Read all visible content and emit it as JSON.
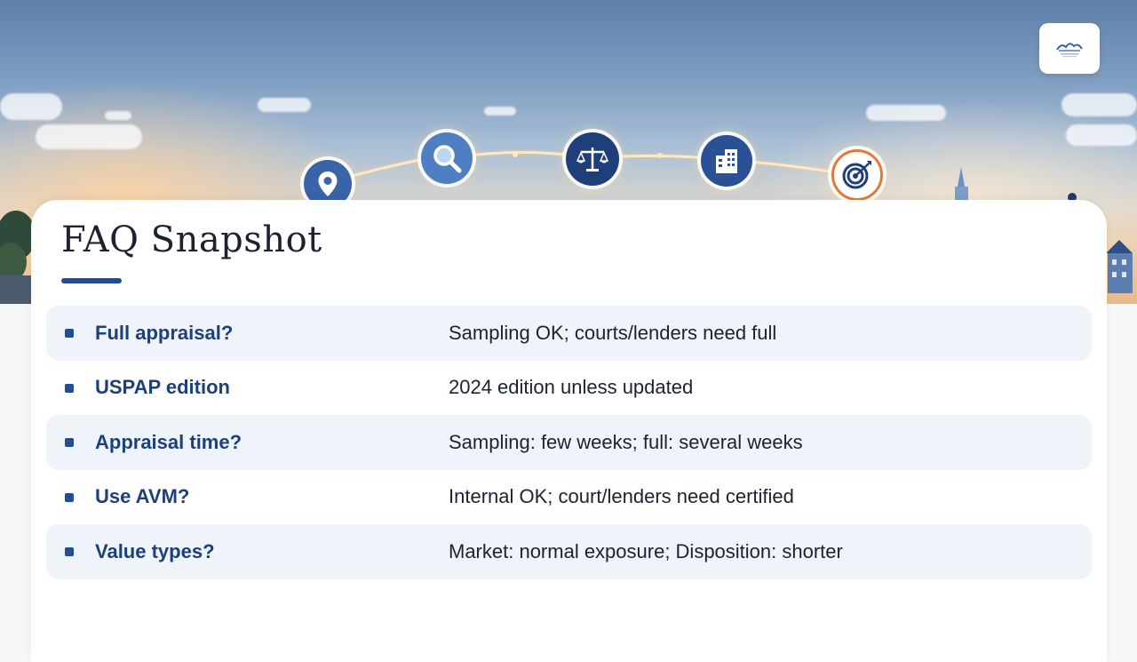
{
  "slide": {
    "title": "FAQ Snapshot"
  },
  "faq": [
    {
      "question": "Full appraisal?",
      "answer": "Sampling OK; courts/lenders need full"
    },
    {
      "question": "USPAP edition",
      "answer": "2024 edition unless updated"
    },
    {
      "question": "Appraisal time?",
      "answer": "Sampling: few weeks; full: several weeks"
    },
    {
      "question": "Use AVM?",
      "answer": "Internal OK; court/lenders need certified"
    },
    {
      "question": "Value types?",
      "answer": "Market: normal exposure; Disposition: shorter"
    }
  ],
  "timeline_icons": [
    "location-pin-icon",
    "magnifier-icon",
    "scales-icon",
    "buildings-icon",
    "target-icon"
  ],
  "colors": {
    "accent": "#1f4e96",
    "question_text": "#1d3f7a",
    "row_shade": "#eff3fa",
    "target_ring": "#e07b3c"
  }
}
